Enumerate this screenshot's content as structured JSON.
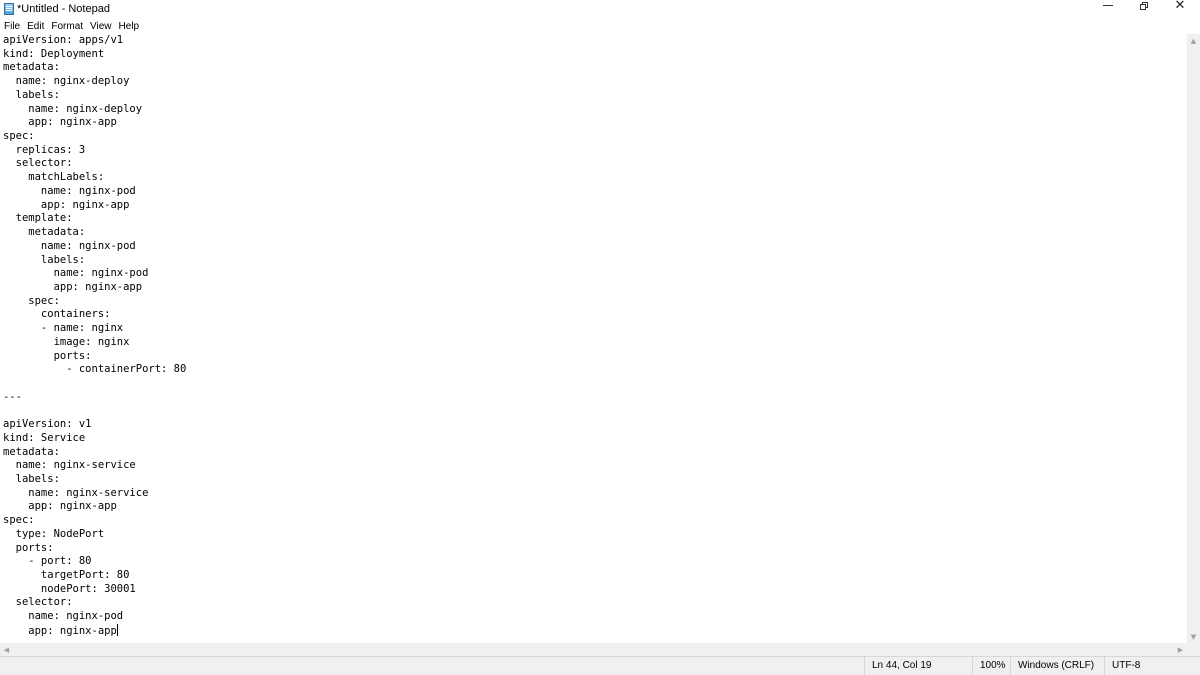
{
  "window": {
    "title": "*Untitled - Notepad",
    "icons": {
      "app": "notepad-icon",
      "minimize": "minimize-icon",
      "maximize": "restore-icon",
      "close": "close-icon"
    },
    "close_glyph": "✕"
  },
  "menu": {
    "items": [
      "File",
      "Edit",
      "Format",
      "View",
      "Help"
    ]
  },
  "editor": {
    "lines": [
      "apiVersion: apps/v1",
      "kind: Deployment",
      "metadata:",
      "  name: nginx-deploy",
      "  labels:",
      "    name: nginx-deploy",
      "    app: nginx-app",
      "spec:",
      "  replicas: 3",
      "  selector:",
      "    matchLabels:",
      "      name: nginx-pod",
      "      app: nginx-app",
      "  template:",
      "    metadata:",
      "      name: nginx-pod",
      "      labels:",
      "        name: nginx-pod",
      "        app: nginx-app",
      "    spec:",
      "      containers:",
      "      - name: nginx",
      "        image: nginx",
      "        ports:",
      "          - containerPort: 80",
      "",
      "---",
      "",
      "apiVersion: v1",
      "kind: Service",
      "metadata:",
      "  name: nginx-service",
      "  labels:",
      "    name: nginx-service",
      "    app: nginx-app",
      "spec:",
      "  type: NodePort",
      "  ports:",
      "    - port: 80",
      "      targetPort: 80",
      "      nodePort: 30001",
      "  selector:",
      "    name: nginx-pod",
      "    app: nginx-app"
    ]
  },
  "scrollbars": {
    "up_arrow": "▲",
    "down_arrow": "▼",
    "left_arrow": "◀",
    "right_arrow": "▶"
  },
  "status": {
    "position": "Ln 44, Col 19",
    "zoom": "100%",
    "line_ending": "Windows (CRLF)",
    "encoding": "UTF-8"
  }
}
